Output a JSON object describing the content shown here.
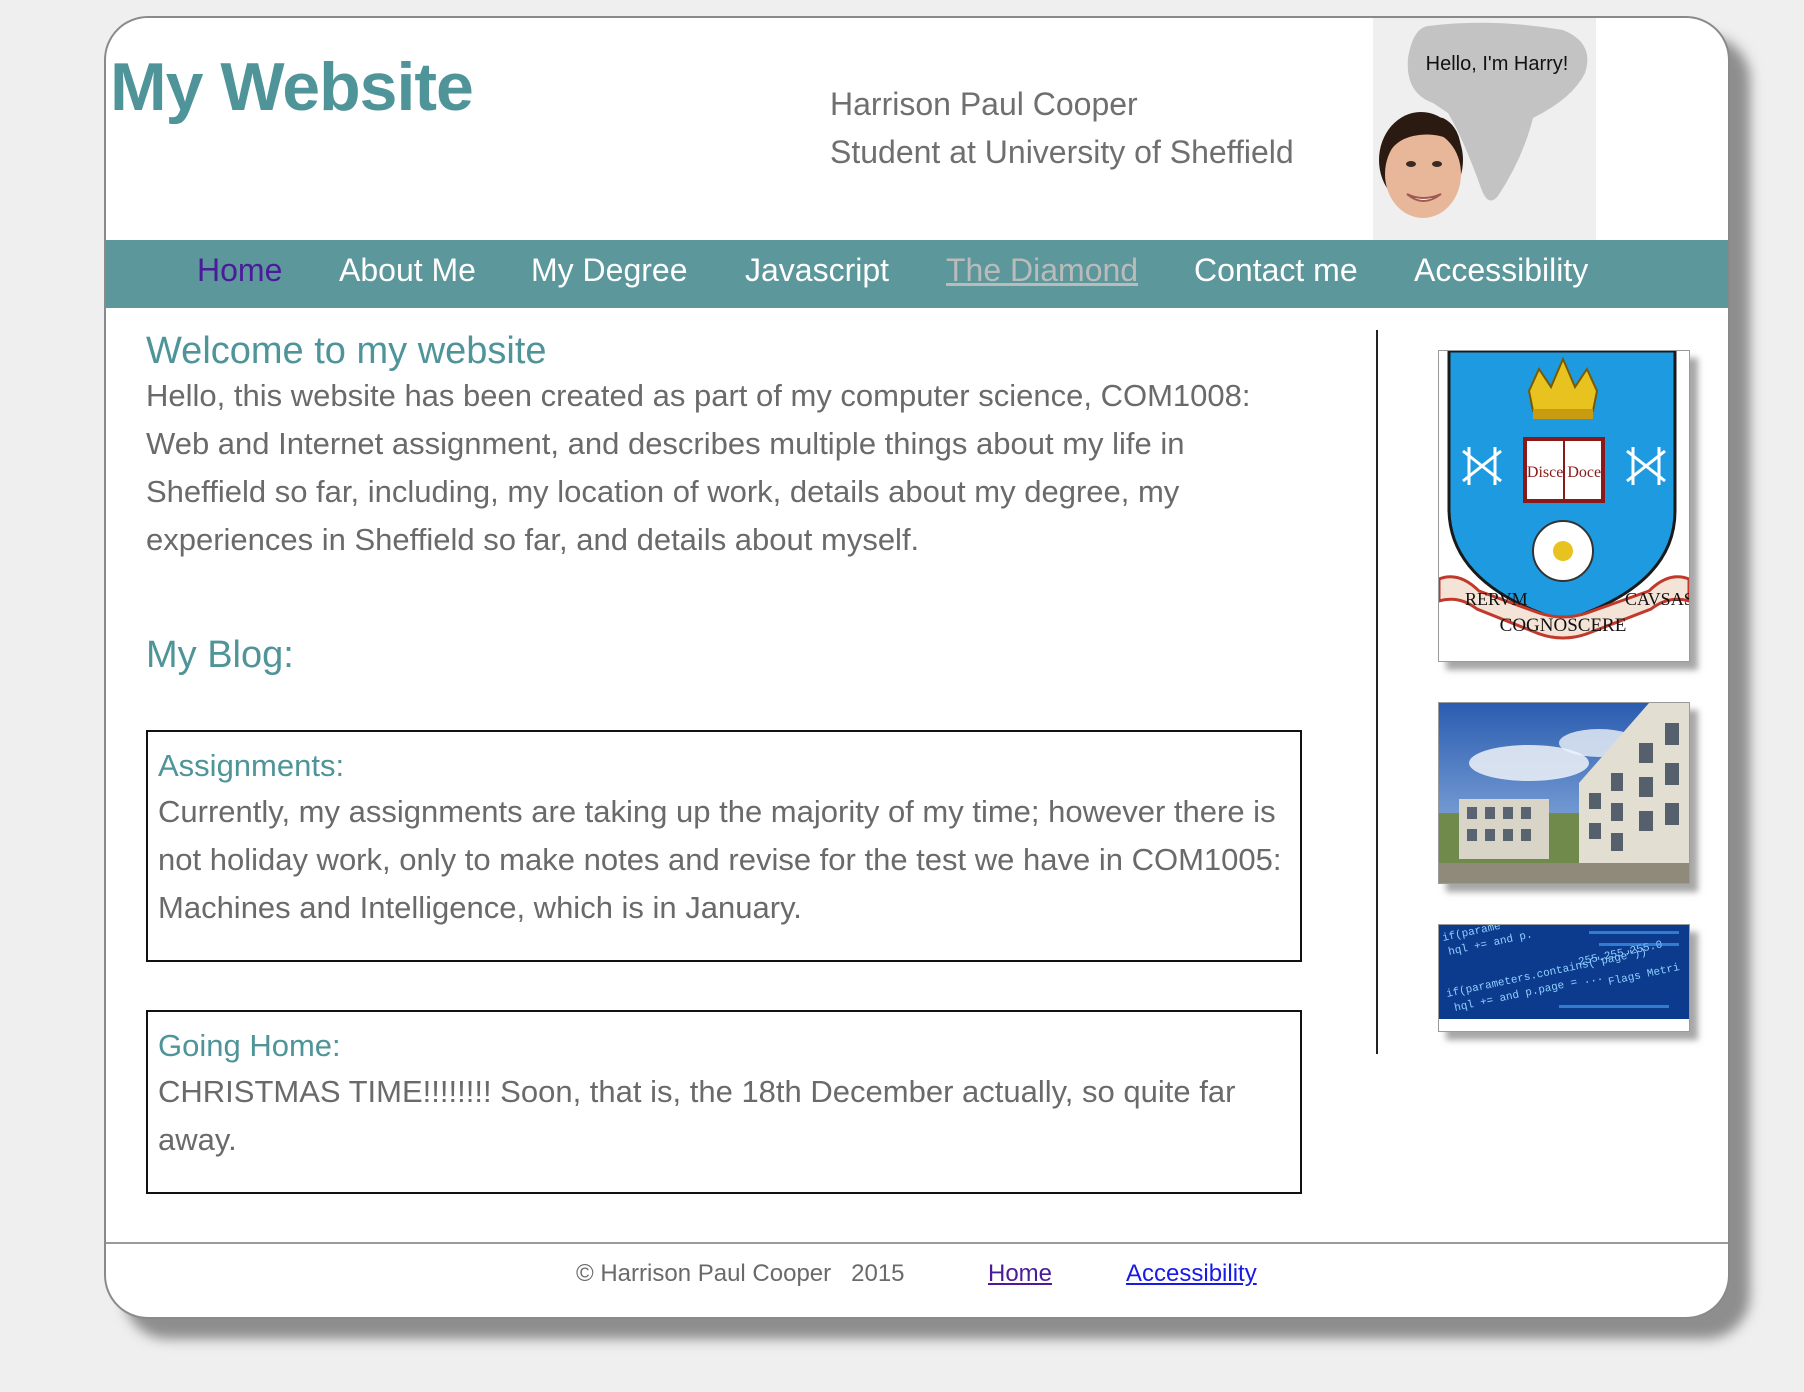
{
  "header": {
    "site_title": "My Website",
    "author_name": "Harrison Paul Cooper",
    "author_subtitle": "Student at University of Sheffield",
    "speech_bubble": "Hello, I'm Harry!"
  },
  "nav": {
    "items": [
      {
        "label": "Home",
        "state": "current"
      },
      {
        "label": "About Me",
        "state": "normal"
      },
      {
        "label": "My Degree",
        "state": "normal"
      },
      {
        "label": "Javascript",
        "state": "normal"
      },
      {
        "label": "The Diamond",
        "state": "visited"
      },
      {
        "label": "Contact me",
        "state": "normal"
      },
      {
        "label": "Accessibility",
        "state": "normal"
      }
    ]
  },
  "main": {
    "welcome_heading": "Welcome to my website",
    "welcome_text": "Hello, this website has been created as part of my computer science, COM1008: Web and Internet assignment, and describes multiple things about my life in Sheffield so far, including, my location of work, details about my degree, my experiences in Sheffield so far, and details about myself.",
    "blog_heading": "My Blog:",
    "blog_posts": [
      {
        "title": "Assignments:",
        "text": "Currently, my assignments are taking up the majority of my time; however there is not holiday work, only to make notes and revise for the test we have in COM1005: Machines and Intelligence, which is in January."
      },
      {
        "title": "Going Home:",
        "text": "CHRISTMAS TIME!!!!!!!! Soon, that is, the 18th December actually, so quite far away."
      }
    ]
  },
  "sidebar": {
    "crest_banner_left": "RERVM",
    "crest_banner_center": "COGNOSCERE",
    "crest_banner_right": "CAVSAS",
    "crest_book": "Disce Doce"
  },
  "footer": {
    "copyright": "© Harrison Paul Cooper   2015",
    "home_link": "Home",
    "accessibility_link": "Accessibility",
    "home_link_color": "#4b1c9a",
    "accessibility_link_color": "#1a1ae6"
  },
  "colors": {
    "accent": "#4e9499",
    "nav_background": "#5b979b",
    "body_text": "#6a6a6a"
  }
}
